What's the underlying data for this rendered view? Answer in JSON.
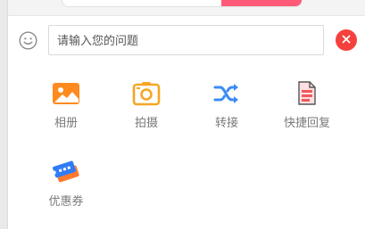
{
  "input": {
    "placeholder": "请输入您的问题",
    "value": ""
  },
  "icons": {
    "emoji": "smiley-face-icon",
    "close": "close-icon"
  },
  "tools": [
    {
      "label": "相册",
      "icon": "photo-album-icon",
      "color": "#ff8a1d"
    },
    {
      "label": "拍摄",
      "icon": "camera-icon",
      "color": "#f5a623"
    },
    {
      "label": "转接",
      "icon": "shuffle-transfer-icon",
      "color": "#3b8cf5"
    },
    {
      "label": "快捷回复",
      "icon": "quick-reply-document-icon",
      "color": "#f05a5a"
    },
    {
      "label": "优惠券",
      "icon": "coupon-ticket-icon",
      "color": "#2f7cf6"
    }
  ],
  "colors": {
    "close_button": "#f5413d",
    "top_accent": "#ff5a78",
    "label_text": "#7a7a7a"
  }
}
